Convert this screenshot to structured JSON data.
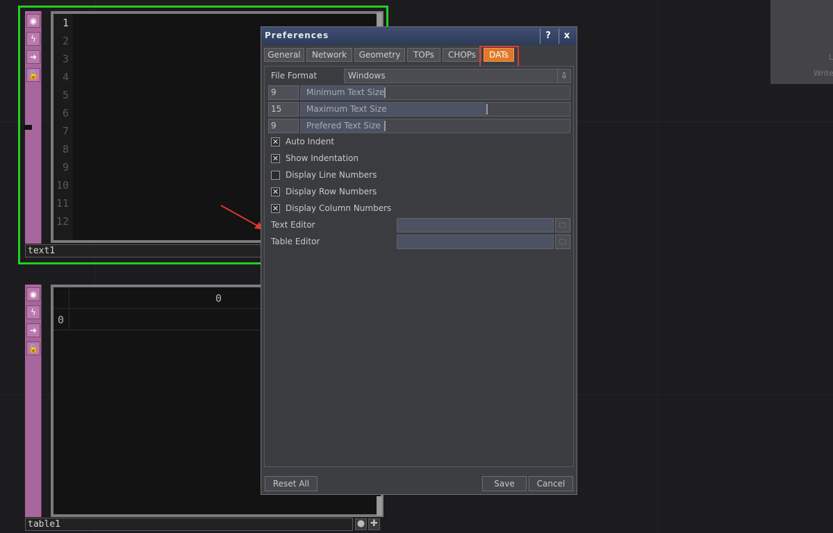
{
  "operators": {
    "text_dat": {
      "name": "text1",
      "line_numbers": [
        "1",
        "2",
        "3",
        "4",
        "5",
        "6",
        "7",
        "8",
        "9",
        "10",
        "11",
        "12"
      ],
      "flag_icons": [
        "viewer-active-icon",
        "bypass-icon",
        "cook-icon",
        "lock-icon"
      ]
    },
    "table_dat": {
      "name": "table1",
      "col_header": "0",
      "row_header": "0"
    }
  },
  "right_panel": {
    "text_fragment_1": "L",
    "text_fragment_2": "Write"
  },
  "dialog": {
    "title": "Preferences",
    "help_label": "?",
    "close_label": "x",
    "tabs": [
      {
        "label": "General",
        "active": false
      },
      {
        "label": "Network",
        "active": false
      },
      {
        "label": "Geometry",
        "active": false
      },
      {
        "label": "TOPs",
        "active": false
      },
      {
        "label": "CHOPs",
        "active": false
      },
      {
        "label": "DATs",
        "active": true
      }
    ],
    "file_format": {
      "label": "File Format",
      "value": "Windows"
    },
    "text_sizes": [
      {
        "value": "9",
        "label": "Minimum Text Size",
        "level": 0.31
      },
      {
        "value": "15",
        "label": "Maximum Text Size",
        "level": 0.69
      },
      {
        "value": "9",
        "label": "Prefered Text Size",
        "level": 0.31
      }
    ],
    "checkboxes": [
      {
        "label": "Auto Indent",
        "checked": true
      },
      {
        "label": "Show Indentation",
        "checked": true
      },
      {
        "label": "Display Line Numbers",
        "checked": false
      },
      {
        "label": "Display Row Numbers",
        "checked": true
      },
      {
        "label": "Display Column Numbers",
        "checked": true
      }
    ],
    "text_editor": {
      "label": "Text Editor",
      "value": ""
    },
    "table_editor": {
      "label": "Table Editor",
      "value": ""
    },
    "buttons": {
      "reset": "Reset All",
      "save": "Save",
      "cancel": "Cancel"
    }
  },
  "colors": {
    "background": "#1c1c1e",
    "selection_outline": "#22d022",
    "dat_rail": "#a8679c",
    "active_tab": "#e07a2a",
    "highlight_box": "#e13a2e",
    "titlebar": "#3f4f72"
  }
}
